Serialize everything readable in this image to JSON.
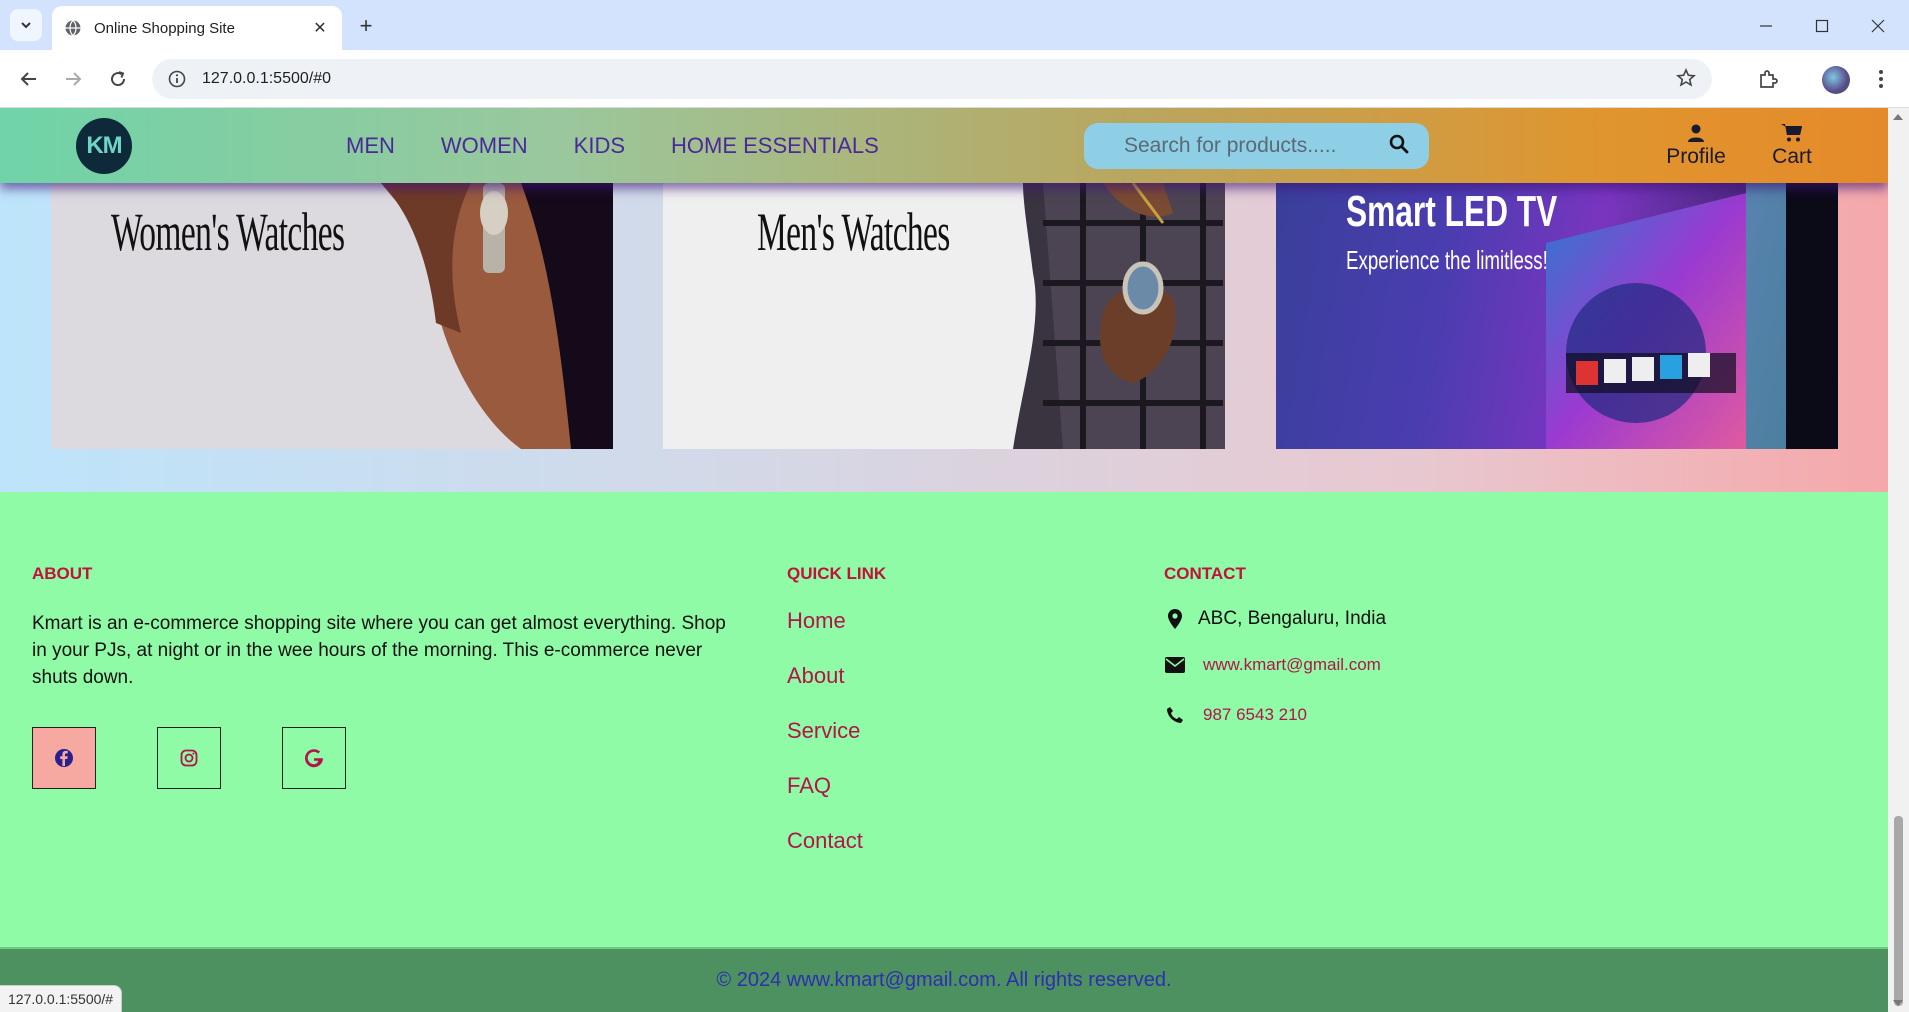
{
  "browser": {
    "tab_title": "Online Shopping Site",
    "url": "127.0.0.1:5500/#0",
    "status_url": "127.0.0.1:5500/#"
  },
  "header": {
    "logo_text": "KM",
    "nav": [
      "MEN",
      "WOMEN",
      "KIDS",
      "HOME ESSENTIALS"
    ],
    "search_placeholder": "Search for products.....",
    "profile_label": "Profile",
    "cart_label": "Cart"
  },
  "banners": {
    "women": "Women's Watches",
    "men": "Men's Watches",
    "tv_title": "Smart LED TV",
    "tv_subtitle": "Experience the limitless!"
  },
  "footer": {
    "about_heading": "ABOUT",
    "about_text": "Kmart is an e-commerce shopping site where you can get almost everything. Shop in your PJs, at night or in the wee hours of the morning. This e-commerce never shuts down.",
    "quick_heading": "QUICK LINK",
    "quick_links": [
      "Home",
      "About",
      "Service",
      "FAQ",
      "Contact"
    ],
    "contact_heading": "CONTACT",
    "address": "ABC, Bengaluru, India",
    "email": "www.kmart@gmail.com",
    "phone": "987 6543 210",
    "social": [
      "facebook-icon",
      "instagram-icon",
      "google-icon"
    ],
    "copyright": "© 2024 www.kmart@gmail.com. All rights reserved."
  },
  "colors": {
    "footer_bg": "#90fba6",
    "heading_red": "#c0123a",
    "link_pink": "#b0164a",
    "nav_purple": "#4a2a9a",
    "copyright_bg": "#4e9160"
  }
}
